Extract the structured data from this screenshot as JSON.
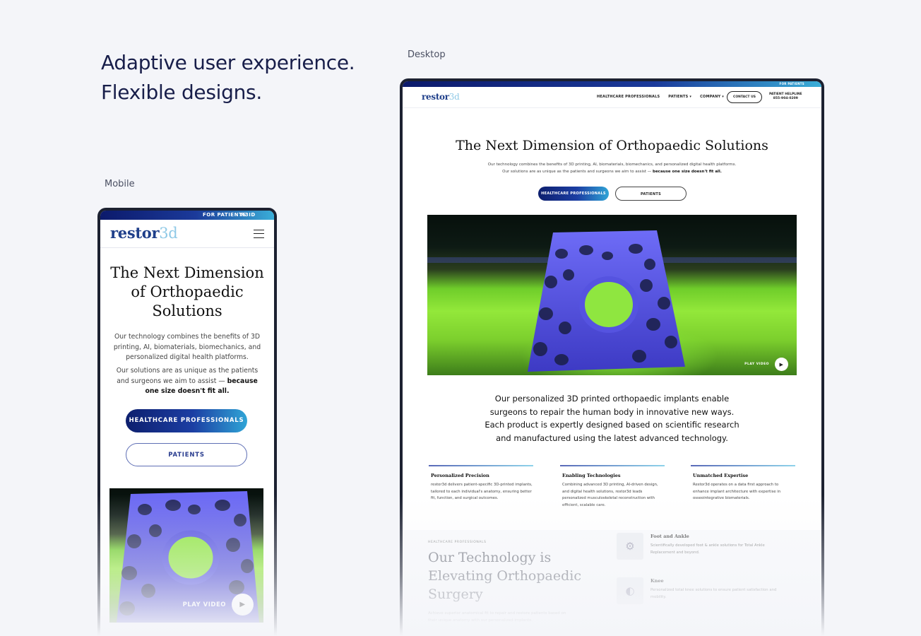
{
  "intro": {
    "line1": "Adaptive user experience.",
    "line2": "Flexible designs.",
    "desktop_label": "Desktop",
    "mobile_label": "Mobile"
  },
  "desktop": {
    "topbar_link": "FOR PATIENTS",
    "logo_main": "restor",
    "logo_thin": "3d",
    "nav": [
      "HEALTHCARE PROFESSIONALS",
      "PATIENTS ▾",
      "COMPANY ▾"
    ],
    "contact_label": "CONTACT US",
    "helpline_label": "PATIENT HELPLINE",
    "helpline_number": "855-904-0209",
    "hero_title": "The Next Dimension of Orthopaedic Solutions",
    "hero_line1": "Our technology combines the benefits of 3D printing, AI, biomaterials, biomechanics, and personalized digital health platforms.",
    "hero_line2_start": "Our solutions are as unique as the patients and surgeons we aim to assist — ",
    "hero_line2_bold": "because one size doesn't fit all.",
    "btn_pro": "HEALTHCARE PROFESSIONALS",
    "btn_patients": "PATIENTS",
    "play_label": "PLAY VIDEO",
    "statement_l1": "Our personalized 3D printed orthopaedic implants enable",
    "statement_l2": "surgeons to repair the human body in innovative new ways.",
    "statement_l3": "Each product is expertly designed based on scientific research",
    "statement_l4": "and manufactured using the latest advanced technology.",
    "features": [
      {
        "title": "Personalized Precision",
        "text": "restor3d delivers patient-specific 3D-printed implants, tailored to each individual's anatomy, ensuring better fit, function, and surgical outcomes."
      },
      {
        "title": "Enabling Technologies",
        "text": "Combining advanced 3D printing, AI-driven design, and digital health solutions, restor3d leads personalized musculoskeletal reconstruction with efficient, scalable care."
      },
      {
        "title": "Unmatched Expertise",
        "text": "Restor3d operates on a data first approach to enhance implant architecture with expertise in osseointegrative biomaterials."
      }
    ],
    "tech_eyebrow": "HEALTHCARE PROFESSIONALS",
    "tech_title_l1": "Our Technology is",
    "tech_title_l2": "Elevating Orthopaedic",
    "tech_title_l3": "Surgery",
    "tech_sub": "Achieve superior anatomical fit to repair and restore patients based on their unique anatomy with our personalized implants.",
    "tech_items": [
      {
        "title": "Foot and Ankle",
        "text": "Scientifically developed foot & ankle solutions for Total Ankle Replacement and beyond."
      },
      {
        "title": "Knee",
        "text": "Personalized total knee solutions to ensure patient satisfaction and mobility."
      }
    ]
  },
  "mobile": {
    "topbar_patients": "FOR PATIENTS",
    "topbar_r3id": "R3ID",
    "logo_main": "restor",
    "logo_thin": "3d",
    "hero_title": "The Next Dimension of Orthopaedic Solutions",
    "hero_p1": "Our technology combines the benefits of 3D printing, AI, biomaterials, biomechanics, and personalized digital health platforms.",
    "hero_p2_start": "Our solutions are as unique as the patients and surgeons we aim to assist — ",
    "hero_p2_bold": "because one size doesn't fit all.",
    "btn_pro": "HEALTHCARE PROFESSIONALS",
    "btn_patients": "PATIENTS",
    "play_label": "PLAY VIDEO"
  },
  "icons": {
    "play": "play-icon",
    "menu": "hamburger-menu-icon"
  },
  "colors": {
    "accent_dark": "#0d1f6e",
    "accent_light": "#2fa4d6",
    "implant_blue": "#5b5cf0",
    "implant_green": "#93e83a"
  }
}
